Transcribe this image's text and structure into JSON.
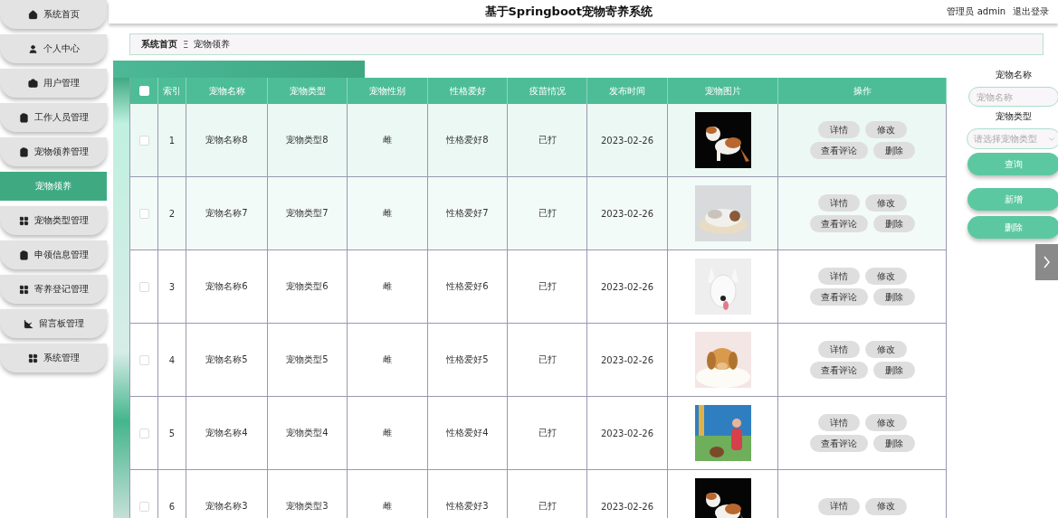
{
  "sidebar": {
    "items": [
      {
        "label": "系统首页",
        "selected": false
      },
      {
        "label": "个人中心",
        "selected": false
      },
      {
        "label": "用户管理",
        "selected": false
      },
      {
        "label": "工作人员管理",
        "selected": false
      },
      {
        "label": "宠物领养管理",
        "selected": false
      },
      {
        "label": "宠物领养",
        "selected": true
      },
      {
        "label": "宠物类型管理",
        "selected": false
      },
      {
        "label": "申领信息管理",
        "selected": false
      },
      {
        "label": "寄养登记管理",
        "selected": false
      },
      {
        "label": "留言板管理",
        "selected": false
      },
      {
        "label": "系统管理",
        "selected": false
      }
    ]
  },
  "header": {
    "title": "基于Springboot宠物寄养系统",
    "user": "管理员 admin",
    "logout": "退出登录"
  },
  "breadcrumb": {
    "home": "系统首页",
    "separator": "Ξ",
    "current": "宠物领养"
  },
  "table": {
    "select_all": {
      "checked": false
    },
    "columns": [
      "索引",
      "宠物名称",
      "宠物类型",
      "宠物性别",
      "性格爱好",
      "疫苗情况",
      "发布时间",
      "宠物图片",
      "操作"
    ],
    "rows": [
      {
        "checked": false,
        "index": "1",
        "name": "宠物名称8",
        "type": "宠物类型8",
        "sex": "雌",
        "hobby": "性格爱好8",
        "vaccine": "已打",
        "date": "2023-02-26",
        "actions": [
          "详情",
          "修改",
          "查看评论",
          "删除"
        ]
      },
      {
        "checked": false,
        "index": "2",
        "name": "宠物名称7",
        "type": "宠物类型7",
        "sex": "雌",
        "hobby": "性格爱好7",
        "vaccine": "已打",
        "date": "2023-02-26",
        "actions": [
          "详情",
          "修改",
          "查看评论",
          "删除"
        ]
      },
      {
        "checked": false,
        "index": "3",
        "name": "宠物名称6",
        "type": "宠物类型6",
        "sex": "雌",
        "hobby": "性格爱好6",
        "vaccine": "已打",
        "date": "2023-02-26",
        "actions": [
          "详情",
          "修改",
          "查看评论",
          "删除"
        ]
      },
      {
        "checked": false,
        "index": "4",
        "name": "宠物名称5",
        "type": "宠物类型5",
        "sex": "雌",
        "hobby": "性格爱好5",
        "vaccine": "已打",
        "date": "2023-02-26",
        "actions": [
          "详情",
          "修改",
          "查看评论",
          "删除"
        ]
      },
      {
        "checked": false,
        "index": "5",
        "name": "宠物名称4",
        "type": "宠物类型4",
        "sex": "雌",
        "hobby": "性格爱好4",
        "vaccine": "已打",
        "date": "2023-02-26",
        "actions": [
          "详情",
          "修改",
          "查看评论",
          "删除"
        ]
      },
      {
        "checked": false,
        "index": "6",
        "name": "宠物名称3",
        "type": "宠物类型3",
        "sex": "雌",
        "hobby": "性格爱好3",
        "vaccine": "已打",
        "date": "2023-02-26",
        "actions": [
          "详情",
          "修改"
        ]
      }
    ]
  },
  "search": {
    "name_label": "宠物名称",
    "name_placeholder": "宠物名称",
    "type_label": "宠物类型",
    "type_placeholder": "请选择宠物类型",
    "query": "查询",
    "add": "新增",
    "delete": "删除"
  }
}
